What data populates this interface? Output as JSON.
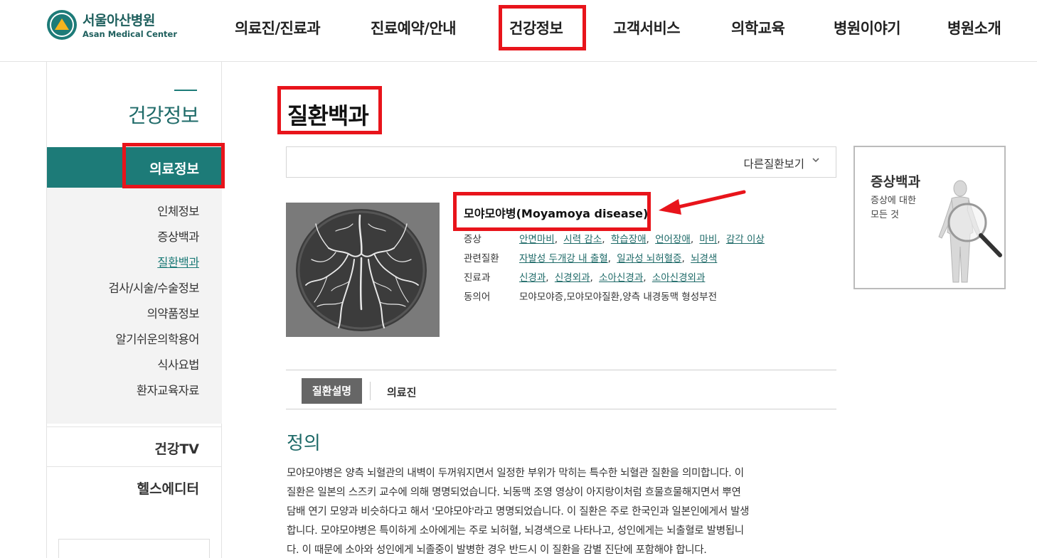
{
  "header": {
    "logo_ko": "서울아산병원",
    "logo_en": "Asan Medical Center",
    "nav": [
      "의료진/진료과",
      "진료예약/안내",
      "건강정보",
      "고객서비스",
      "의학교육",
      "병원이야기",
      "병원소개"
    ]
  },
  "sidebar": {
    "title": "건강정보",
    "active_section": "의료정보",
    "sub_items": [
      "인체정보",
      "증상백과",
      "질환백과",
      "검사/시술/수술정보",
      "의약품정보",
      "알기쉬운의학용어",
      "식사요법",
      "환자교육자료"
    ],
    "active_sub": "질환백과",
    "sections": [
      "건강TV",
      "헬스에디터"
    ]
  },
  "main": {
    "page_title": "질환백과",
    "select_label": "다른질환보기",
    "disease": {
      "name": "모야모야병(Moyamoya disease)",
      "rows": [
        {
          "label": "증상",
          "links": [
            "안면마비",
            "시력 감소",
            "학습장애",
            "언어장애",
            "마비",
            "감각 이상"
          ]
        },
        {
          "label": "관련질환",
          "links": [
            "자발성 두개강 내 출혈",
            "일과성 뇌허혈증",
            "뇌경색"
          ]
        },
        {
          "label": "진료과",
          "links": [
            "신경과",
            "신경외과",
            "소아신경과",
            "소아신경외과"
          ]
        },
        {
          "label": "동의어",
          "text": "모야모야증,모야모야질환,양측 내경동맥 형성부전"
        }
      ]
    },
    "tabs": [
      "질환설명",
      "의료진"
    ],
    "section_title": "정의",
    "section_lines": [
      "모야모야병은 양측 뇌혈관의 내벽이 두꺼워지면서 일정한 부위가 막히는 특수한 뇌혈관 질환을 의미합니다. 이",
      "질환은 일본의 스즈키 교수에 의해 명명되었습니다. 뇌동맥 조영 영상이 아지랑이처럼 흐물흐물해지면서 뿌연",
      "담배 연기 모양과 비슷하다고 해서 '모야모야'라고 명명되었습니다. 이 질환은 주로 한국인과 일본인에게서 발생",
      "합니다. 모야모야병은 특이하게 소아에게는 주로 뇌허혈, 뇌경색으로 나타나고, 성인에게는 뇌출혈로 발병됩니",
      "다. 이 때문에 소아와 성인에게 뇌졸중이 발병한 경우 반드시 이 질환을 감별 진단에 포함해야 합니다."
    ]
  },
  "promo": {
    "title": "증상백과",
    "subtitle_lines": [
      "증상에 대한",
      "모든 것"
    ]
  },
  "colors": {
    "brand_teal": "#1d7b78",
    "highlight_red": "#e8141b"
  }
}
